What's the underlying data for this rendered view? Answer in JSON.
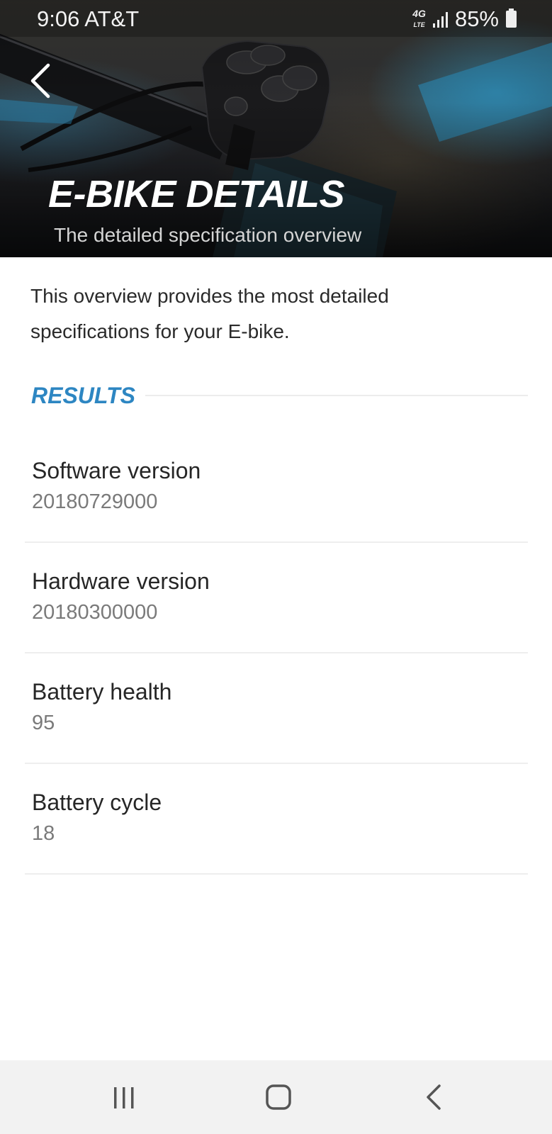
{
  "status_bar": {
    "time": "9:06",
    "carrier": "AT&T",
    "network": "4G LTE",
    "battery_percent": "85%",
    "icons": [
      "network-4g-lte-icon",
      "signal-strength-icon",
      "battery-icon"
    ]
  },
  "header": {
    "back_icon": "chevron-left-icon",
    "title": "E-BIKE DETAILS",
    "subtitle": "The detailed specification overview"
  },
  "intro_text": "This overview provides the most detailed specifications for your E-bike.",
  "results": {
    "title": "RESULTS",
    "items": [
      {
        "label": "Software version",
        "value": "20180729000"
      },
      {
        "label": "Hardware version",
        "value": "20180300000"
      },
      {
        "label": "Battery health",
        "value": "95"
      },
      {
        "label": "Battery cycle",
        "value": "18"
      }
    ]
  },
  "nav_bar": {
    "icons": [
      "recents-icon",
      "home-icon",
      "back-icon"
    ]
  },
  "colors": {
    "accent": "#2d86c2",
    "label_text": "#262626",
    "value_text": "#7a7a7a",
    "nav_background": "#f2f2f2"
  }
}
